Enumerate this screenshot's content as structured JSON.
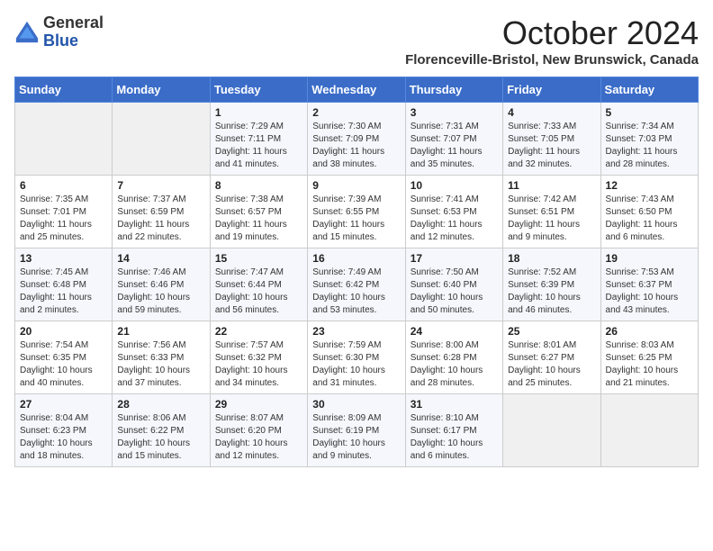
{
  "logo": {
    "general": "General",
    "blue": "Blue"
  },
  "title": "October 2024",
  "subtitle": "Florenceville-Bristol, New Brunswick, Canada",
  "days_of_week": [
    "Sunday",
    "Monday",
    "Tuesday",
    "Wednesday",
    "Thursday",
    "Friday",
    "Saturday"
  ],
  "weeks": [
    [
      {
        "num": "",
        "sunrise": "",
        "sunset": "",
        "daylight": ""
      },
      {
        "num": "",
        "sunrise": "",
        "sunset": "",
        "daylight": ""
      },
      {
        "num": "1",
        "sunrise": "Sunrise: 7:29 AM",
        "sunset": "Sunset: 7:11 PM",
        "daylight": "Daylight: 11 hours and 41 minutes."
      },
      {
        "num": "2",
        "sunrise": "Sunrise: 7:30 AM",
        "sunset": "Sunset: 7:09 PM",
        "daylight": "Daylight: 11 hours and 38 minutes."
      },
      {
        "num": "3",
        "sunrise": "Sunrise: 7:31 AM",
        "sunset": "Sunset: 7:07 PM",
        "daylight": "Daylight: 11 hours and 35 minutes."
      },
      {
        "num": "4",
        "sunrise": "Sunrise: 7:33 AM",
        "sunset": "Sunset: 7:05 PM",
        "daylight": "Daylight: 11 hours and 32 minutes."
      },
      {
        "num": "5",
        "sunrise": "Sunrise: 7:34 AM",
        "sunset": "Sunset: 7:03 PM",
        "daylight": "Daylight: 11 hours and 28 minutes."
      }
    ],
    [
      {
        "num": "6",
        "sunrise": "Sunrise: 7:35 AM",
        "sunset": "Sunset: 7:01 PM",
        "daylight": "Daylight: 11 hours and 25 minutes."
      },
      {
        "num": "7",
        "sunrise": "Sunrise: 7:37 AM",
        "sunset": "Sunset: 6:59 PM",
        "daylight": "Daylight: 11 hours and 22 minutes."
      },
      {
        "num": "8",
        "sunrise": "Sunrise: 7:38 AM",
        "sunset": "Sunset: 6:57 PM",
        "daylight": "Daylight: 11 hours and 19 minutes."
      },
      {
        "num": "9",
        "sunrise": "Sunrise: 7:39 AM",
        "sunset": "Sunset: 6:55 PM",
        "daylight": "Daylight: 11 hours and 15 minutes."
      },
      {
        "num": "10",
        "sunrise": "Sunrise: 7:41 AM",
        "sunset": "Sunset: 6:53 PM",
        "daylight": "Daylight: 11 hours and 12 minutes."
      },
      {
        "num": "11",
        "sunrise": "Sunrise: 7:42 AM",
        "sunset": "Sunset: 6:51 PM",
        "daylight": "Daylight: 11 hours and 9 minutes."
      },
      {
        "num": "12",
        "sunrise": "Sunrise: 7:43 AM",
        "sunset": "Sunset: 6:50 PM",
        "daylight": "Daylight: 11 hours and 6 minutes."
      }
    ],
    [
      {
        "num": "13",
        "sunrise": "Sunrise: 7:45 AM",
        "sunset": "Sunset: 6:48 PM",
        "daylight": "Daylight: 11 hours and 2 minutes."
      },
      {
        "num": "14",
        "sunrise": "Sunrise: 7:46 AM",
        "sunset": "Sunset: 6:46 PM",
        "daylight": "Daylight: 10 hours and 59 minutes."
      },
      {
        "num": "15",
        "sunrise": "Sunrise: 7:47 AM",
        "sunset": "Sunset: 6:44 PM",
        "daylight": "Daylight: 10 hours and 56 minutes."
      },
      {
        "num": "16",
        "sunrise": "Sunrise: 7:49 AM",
        "sunset": "Sunset: 6:42 PM",
        "daylight": "Daylight: 10 hours and 53 minutes."
      },
      {
        "num": "17",
        "sunrise": "Sunrise: 7:50 AM",
        "sunset": "Sunset: 6:40 PM",
        "daylight": "Daylight: 10 hours and 50 minutes."
      },
      {
        "num": "18",
        "sunrise": "Sunrise: 7:52 AM",
        "sunset": "Sunset: 6:39 PM",
        "daylight": "Daylight: 10 hours and 46 minutes."
      },
      {
        "num": "19",
        "sunrise": "Sunrise: 7:53 AM",
        "sunset": "Sunset: 6:37 PM",
        "daylight": "Daylight: 10 hours and 43 minutes."
      }
    ],
    [
      {
        "num": "20",
        "sunrise": "Sunrise: 7:54 AM",
        "sunset": "Sunset: 6:35 PM",
        "daylight": "Daylight: 10 hours and 40 minutes."
      },
      {
        "num": "21",
        "sunrise": "Sunrise: 7:56 AM",
        "sunset": "Sunset: 6:33 PM",
        "daylight": "Daylight: 10 hours and 37 minutes."
      },
      {
        "num": "22",
        "sunrise": "Sunrise: 7:57 AM",
        "sunset": "Sunset: 6:32 PM",
        "daylight": "Daylight: 10 hours and 34 minutes."
      },
      {
        "num": "23",
        "sunrise": "Sunrise: 7:59 AM",
        "sunset": "Sunset: 6:30 PM",
        "daylight": "Daylight: 10 hours and 31 minutes."
      },
      {
        "num": "24",
        "sunrise": "Sunrise: 8:00 AM",
        "sunset": "Sunset: 6:28 PM",
        "daylight": "Daylight: 10 hours and 28 minutes."
      },
      {
        "num": "25",
        "sunrise": "Sunrise: 8:01 AM",
        "sunset": "Sunset: 6:27 PM",
        "daylight": "Daylight: 10 hours and 25 minutes."
      },
      {
        "num": "26",
        "sunrise": "Sunrise: 8:03 AM",
        "sunset": "Sunset: 6:25 PM",
        "daylight": "Daylight: 10 hours and 21 minutes."
      }
    ],
    [
      {
        "num": "27",
        "sunrise": "Sunrise: 8:04 AM",
        "sunset": "Sunset: 6:23 PM",
        "daylight": "Daylight: 10 hours and 18 minutes."
      },
      {
        "num": "28",
        "sunrise": "Sunrise: 8:06 AM",
        "sunset": "Sunset: 6:22 PM",
        "daylight": "Daylight: 10 hours and 15 minutes."
      },
      {
        "num": "29",
        "sunrise": "Sunrise: 8:07 AM",
        "sunset": "Sunset: 6:20 PM",
        "daylight": "Daylight: 10 hours and 12 minutes."
      },
      {
        "num": "30",
        "sunrise": "Sunrise: 8:09 AM",
        "sunset": "Sunset: 6:19 PM",
        "daylight": "Daylight: 10 hours and 9 minutes."
      },
      {
        "num": "31",
        "sunrise": "Sunrise: 8:10 AM",
        "sunset": "Sunset: 6:17 PM",
        "daylight": "Daylight: 10 hours and 6 minutes."
      },
      {
        "num": "",
        "sunrise": "",
        "sunset": "",
        "daylight": ""
      },
      {
        "num": "",
        "sunrise": "",
        "sunset": "",
        "daylight": ""
      }
    ]
  ]
}
